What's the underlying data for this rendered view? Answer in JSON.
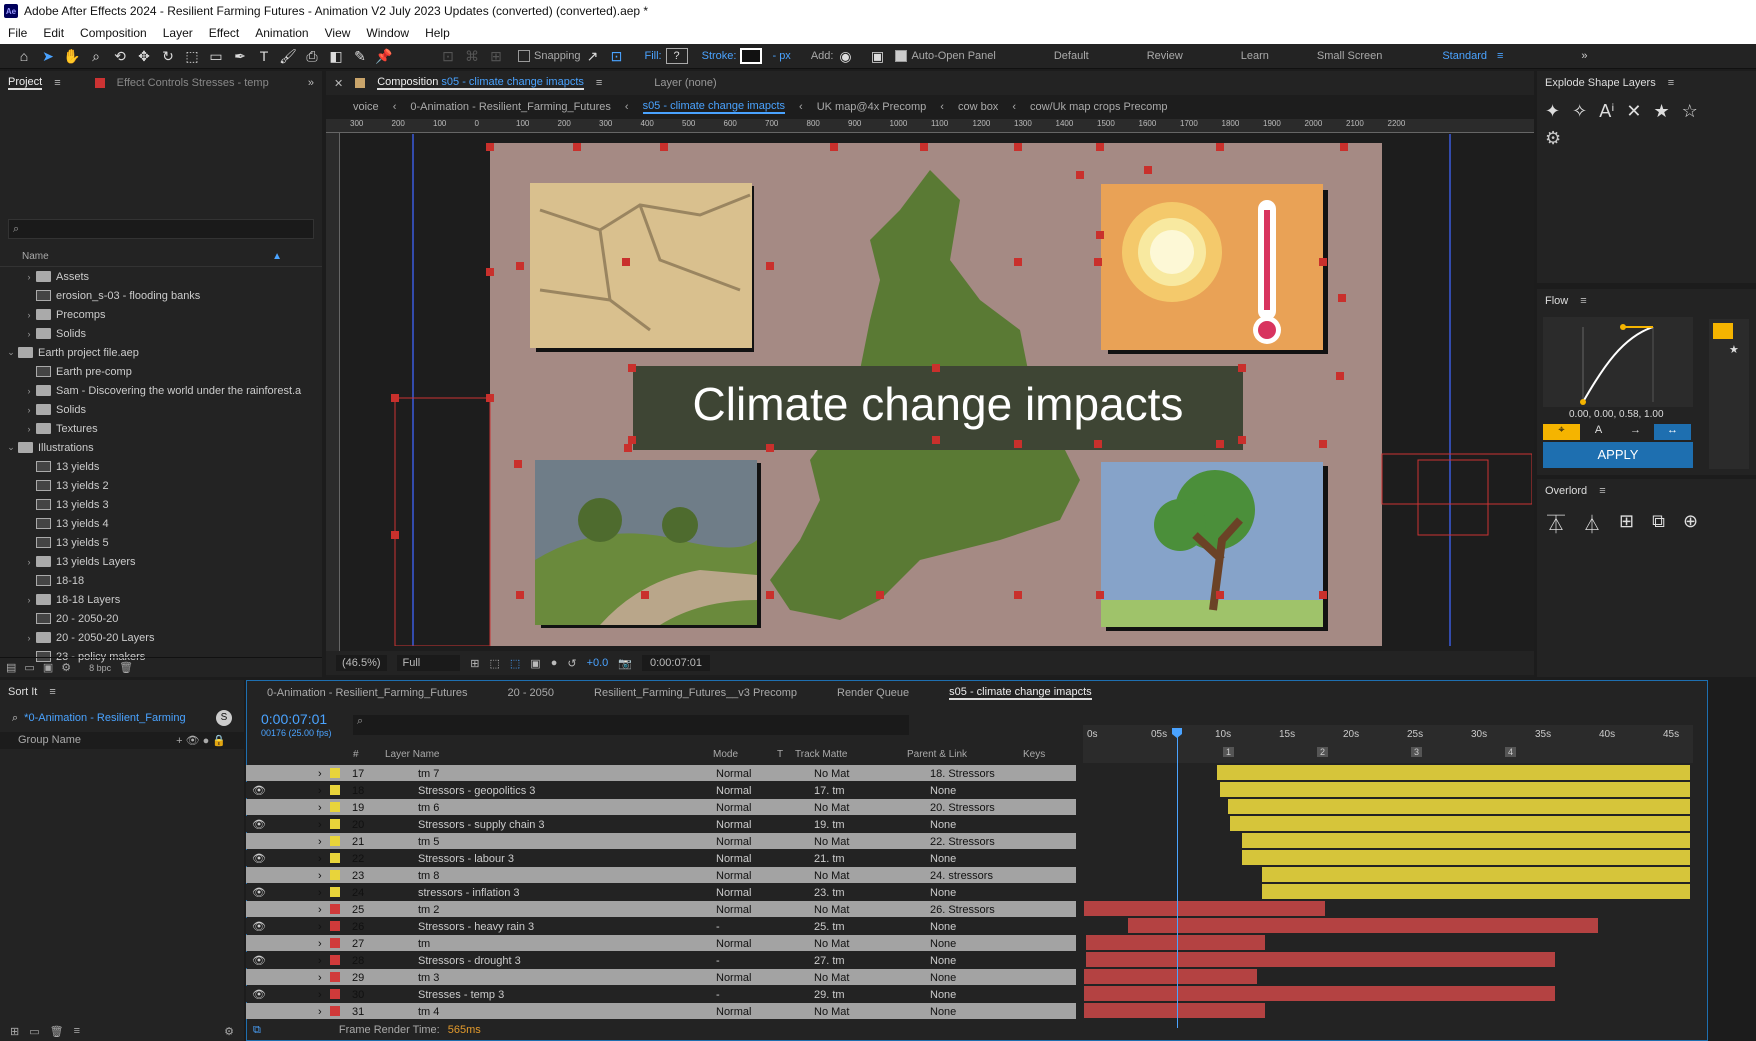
{
  "title": "Adobe After Effects 2024 - Resilient Farming Futures - Animation V2 July 2023 Updates (converted) (converted).aep *",
  "app_badge": "Ae",
  "menu": [
    "File",
    "Edit",
    "Composition",
    "Layer",
    "Effect",
    "Animation",
    "View",
    "Window",
    "Help"
  ],
  "toolbar": {
    "snapping": "Snapping",
    "fill": "Fill:",
    "fill_value": "?",
    "stroke": "Stroke:",
    "stroke_unit": "- px",
    "add": "Add:",
    "auto_open": "Auto-Open Panel",
    "workspaces": [
      "Default",
      "Review",
      "Learn",
      "Small Screen",
      "Standard"
    ]
  },
  "project": {
    "tab": "Project",
    "effect_tab": "Effect Controls Stresses - temp",
    "search_placeholder": "",
    "name_col": "Name",
    "bpc": "8 bpc",
    "items": [
      {
        "label": "Assets",
        "type": "folder",
        "indent": 1,
        "expand": "closed"
      },
      {
        "label": "erosion_s-03 - flooding banks",
        "type": "comp",
        "indent": 1,
        "expand": "none"
      },
      {
        "label": "Precomps",
        "type": "folder",
        "indent": 1,
        "expand": "closed"
      },
      {
        "label": "Solids",
        "type": "folder",
        "indent": 1,
        "expand": "closed"
      },
      {
        "label": "Earth project file.aep",
        "type": "folder",
        "indent": 0,
        "expand": "open"
      },
      {
        "label": "Earth pre-comp",
        "type": "comp",
        "indent": 1,
        "expand": "none"
      },
      {
        "label": "Sam - Discovering the world under the rainforest.a",
        "type": "folder",
        "indent": 1,
        "expand": "closed"
      },
      {
        "label": "Solids",
        "type": "folder",
        "indent": 1,
        "expand": "closed"
      },
      {
        "label": "Textures",
        "type": "folder",
        "indent": 1,
        "expand": "closed"
      },
      {
        "label": "Illustrations",
        "type": "folder",
        "indent": 0,
        "expand": "open"
      },
      {
        "label": "13 yields",
        "type": "comp",
        "indent": 1,
        "expand": "none"
      },
      {
        "label": "13 yields 2",
        "type": "comp",
        "indent": 1,
        "expand": "none"
      },
      {
        "label": "13 yields 3",
        "type": "comp",
        "indent": 1,
        "expand": "none"
      },
      {
        "label": "13 yields 4",
        "type": "comp",
        "indent": 1,
        "expand": "none"
      },
      {
        "label": "13 yields 5",
        "type": "comp",
        "indent": 1,
        "expand": "none"
      },
      {
        "label": "13 yields Layers",
        "type": "folder",
        "indent": 1,
        "expand": "closed"
      },
      {
        "label": "18-18",
        "type": "comp",
        "indent": 1,
        "expand": "none"
      },
      {
        "label": "18-18 Layers",
        "type": "folder",
        "indent": 1,
        "expand": "closed"
      },
      {
        "label": "20 - 2050-20",
        "type": "comp",
        "indent": 1,
        "expand": "none"
      },
      {
        "label": "20 - 2050-20 Layers",
        "type": "folder",
        "indent": 1,
        "expand": "closed"
      },
      {
        "label": "23 - policy makers",
        "type": "comp",
        "indent": 1,
        "expand": "none"
      }
    ]
  },
  "comp": {
    "tab_prefix": "Composition",
    "tab_name": "s05 - climate change imapcts",
    "layer_tab": "Layer (none)",
    "breadcrumbs": [
      "voice",
      "0-Animation - Resilient_Farming_Futures",
      "s05 - climate change imapcts",
      "UK map@4x Precomp",
      "cow box",
      "cow/Uk map crops Precomp"
    ],
    "ruler": [
      "300",
      "200",
      "100",
      "0",
      "100",
      "200",
      "300",
      "400",
      "500",
      "600",
      "700",
      "800",
      "900",
      "1000",
      "1100",
      "1200",
      "1300",
      "1400",
      "1500",
      "1600",
      "1700",
      "1800",
      "1900",
      "2000",
      "2100",
      "2200"
    ],
    "headline": "Climate change impacts",
    "zoom": "(46.5%)",
    "resolution": "Full",
    "exposure": "+0.0",
    "timecode": "0:00:07:01"
  },
  "explode": {
    "title": "Explode Shape Layers"
  },
  "flow": {
    "title": "Flow",
    "values": "0.00, 0.00, 0.58, 1.00",
    "apply": "APPLY"
  },
  "overlord": {
    "title": "Overlord"
  },
  "timeline": {
    "sortit": "Sort It",
    "sort_comp": "*0-Animation - Resilient_Farming",
    "group_col": "Group Name",
    "tabs": [
      "0-Animation - Resilient_Farming_Futures",
      "20 - 2050",
      "Resilient_Farming_Futures__v3 Precomp",
      "Render Queue",
      "s05 - climate change imapcts"
    ],
    "timecode": "0:00:07:01",
    "frames": "00176 (25.00 fps)",
    "cols": {
      "num": "#",
      "layer": "Layer Name",
      "mode": "Mode",
      "t": "T",
      "matte": "Track Matte",
      "parent": "Parent & Link",
      "keys": "Keys"
    },
    "ruler": [
      "0s",
      "05s",
      "10s",
      "15s",
      "20s",
      "25s",
      "30s",
      "35s",
      "40s",
      "45s"
    ],
    "markers": [
      "1",
      "2",
      "3",
      "4"
    ],
    "render_label": "Frame Render Time:",
    "render_value": "565ms",
    "layers": [
      {
        "n": "17",
        "name": "tm 7",
        "color": "#e8d43a",
        "mode": "Normal",
        "matte": "No Mat",
        "parent": "18. Stressors",
        "eye": false,
        "hl": true
      },
      {
        "n": "18",
        "name": "Stressors - geopolitics 3",
        "color": "#e8d43a",
        "mode": "Normal",
        "matte": "17. tm",
        "parent": "None",
        "eye": true,
        "hl": false
      },
      {
        "n": "19",
        "name": "tm 6",
        "color": "#e8d43a",
        "mode": "Normal",
        "matte": "No Mat",
        "parent": "20. Stressors",
        "eye": false,
        "hl": true
      },
      {
        "n": "20",
        "name": "Stressors - supply chain 3",
        "color": "#e8d43a",
        "mode": "Normal",
        "matte": "19. tm",
        "parent": "None",
        "eye": true,
        "hl": false
      },
      {
        "n": "21",
        "name": "tm 5",
        "color": "#e8d43a",
        "mode": "Normal",
        "matte": "No Mat",
        "parent": "22. Stressors",
        "eye": false,
        "hl": true
      },
      {
        "n": "22",
        "name": "Stressors - labour 3",
        "color": "#e8d43a",
        "mode": "Normal",
        "matte": "21. tm",
        "parent": "None",
        "eye": true,
        "hl": false
      },
      {
        "n": "23",
        "name": "tm 8",
        "color": "#e8d43a",
        "mode": "Normal",
        "matte": "No Mat",
        "parent": "24. stressors",
        "eye": false,
        "hl": true
      },
      {
        "n": "24",
        "name": "stressors - inflation 3",
        "color": "#e8d43a",
        "mode": "Normal",
        "matte": "23. tm",
        "parent": "None",
        "eye": true,
        "hl": false
      },
      {
        "n": "25",
        "name": "tm 2",
        "color": "#d03a3a",
        "mode": "Normal",
        "matte": "No Mat",
        "parent": "26. Stressors",
        "eye": false,
        "hl": true
      },
      {
        "n": "26",
        "name": "Stressors - heavy rain 3",
        "color": "#d03a3a",
        "mode": "-",
        "matte": "25. tm",
        "parent": "None",
        "eye": true,
        "hl": false
      },
      {
        "n": "27",
        "name": "tm",
        "color": "#d03a3a",
        "mode": "Normal",
        "matte": "No Mat",
        "parent": "None",
        "eye": false,
        "hl": true
      },
      {
        "n": "28",
        "name": "Stressors - drought 3",
        "color": "#d03a3a",
        "mode": "-",
        "matte": "27. tm",
        "parent": "None",
        "eye": true,
        "hl": false
      },
      {
        "n": "29",
        "name": "tm 3",
        "color": "#d03a3a",
        "mode": "Normal",
        "matte": "No Mat",
        "parent": "None",
        "eye": false,
        "hl": true
      },
      {
        "n": "30",
        "name": "Stresses - temp 3",
        "color": "#d03a3a",
        "mode": "-",
        "matte": "29. tm",
        "parent": "None",
        "eye": true,
        "hl": false
      },
      {
        "n": "31",
        "name": "tm 4",
        "color": "#d03a3a",
        "mode": "Normal",
        "matte": "No Mat",
        "parent": "None",
        "eye": false,
        "hl": true
      }
    ]
  }
}
